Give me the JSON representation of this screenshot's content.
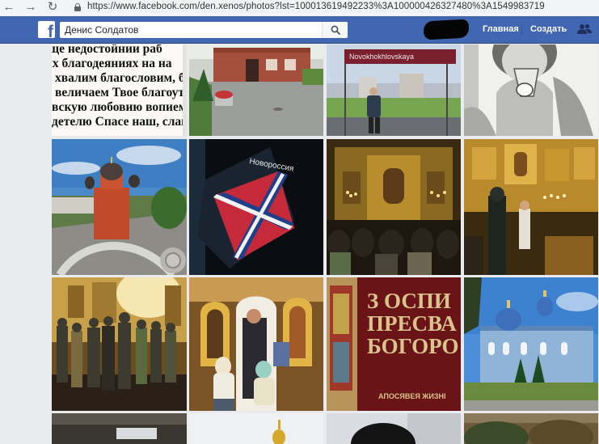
{
  "browser": {
    "url": "https://www.facebook.com/den.xenos/photos?lst=100013619492233%3A100000426327480%3A1549983719",
    "back_icon": "arrow-left",
    "forward_icon": "arrow-right",
    "reload_icon": "reload"
  },
  "header": {
    "search_value": "Денис Солдатов",
    "home_label": "Главная",
    "create_label": "Создать",
    "brand_letter": "f",
    "brand_color": "#4267b2"
  },
  "photos": {
    "prayer_text": [
      "ще недостойнии раб",
      "их благодеяниях на на",
      "хвалим благословим, бл",
      "величаем Твое благоутр",
      "вскую любовию вопием Т",
      "детелю Спасе наш, слава"
    ],
    "station_sign": "Novokhokhlovskaya",
    "flag_text": "Новороссия",
    "book_lines": [
      "З ОСПИ",
      "ПРЕСВА",
      "БОГОРО"
    ],
    "book_footer": "АПОСЯВЕЯ ЖИЗНІ"
  }
}
